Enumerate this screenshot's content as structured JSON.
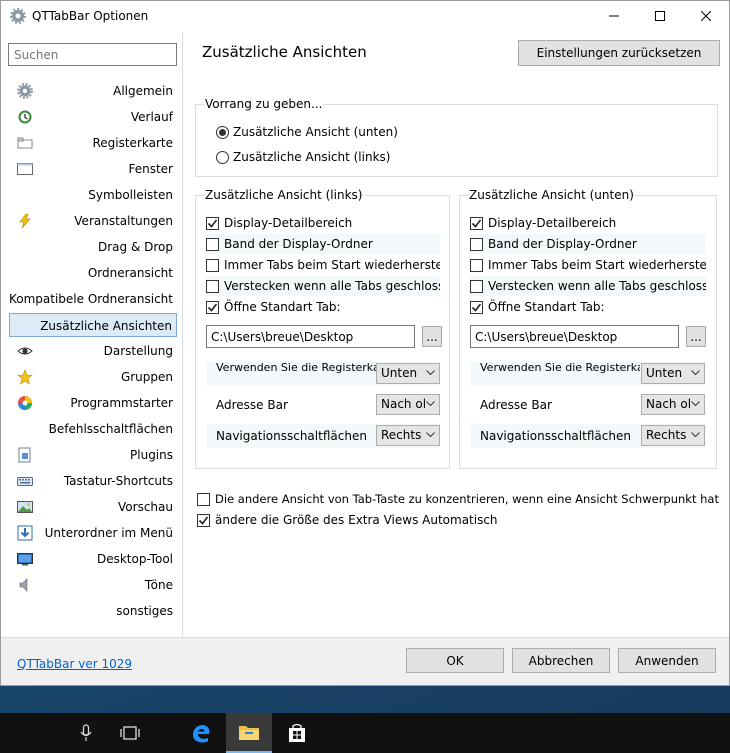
{
  "window": {
    "title": "QTTabBar Optionen"
  },
  "sidebar": {
    "search_placeholder": "Suchen",
    "items": [
      {
        "label": "Allgemein",
        "icon": "gear-icon"
      },
      {
        "label": "Verlauf",
        "icon": "history-icon"
      },
      {
        "label": "Registerkarte",
        "icon": "tab-icon"
      },
      {
        "label": "Fenster",
        "icon": "window-icon"
      },
      {
        "label": "Symbolleisten",
        "icon": ""
      },
      {
        "label": "Veranstaltungen",
        "icon": "lightning-icon"
      },
      {
        "label": "Drag & Drop",
        "icon": ""
      },
      {
        "label": "Ordneransicht",
        "icon": ""
      },
      {
        "label": "Kompatibele Ordneransicht",
        "icon": ""
      },
      {
        "label": "Zusätzliche Ansichten",
        "icon": ""
      },
      {
        "label": "Darstellung",
        "icon": "eye-icon"
      },
      {
        "label": "Gruppen",
        "icon": "star-icon"
      },
      {
        "label": "Programmstarter",
        "icon": "color-wheel-icon"
      },
      {
        "label": "Befehlsschaltflächen",
        "icon": ""
      },
      {
        "label": "Plugins",
        "icon": "plugin-icon"
      },
      {
        "label": "Tastatur-Shortcuts",
        "icon": "keyboard-icon"
      },
      {
        "label": "Vorschau",
        "icon": "preview-icon"
      },
      {
        "label": "Unterordner im Menü",
        "icon": "subfolder-icon"
      },
      {
        "label": "Desktop-Tool",
        "icon": "desktop-icon"
      },
      {
        "label": "Töne",
        "icon": "speaker-icon"
      },
      {
        "label": "sonstiges",
        "icon": ""
      }
    ],
    "selected_index": 9
  },
  "main": {
    "title": "Zusätzliche Ansichten",
    "reset_label": "Einstellungen zurücksetzen",
    "priority": {
      "title": "Vorrang zu geben...",
      "options": [
        "Zusätzliche Ansicht (unten)",
        "Zusätzliche Ansicht (links)"
      ],
      "selected_index": 0
    },
    "left_panel": {
      "title": "Zusätzliche Ansicht (links)",
      "checks": [
        {
          "label": "Display-Detailbereich",
          "checked": true
        },
        {
          "label": "Band der Display-Ordner",
          "checked": false
        },
        {
          "label": "Immer Tabs beim Start wiederherstellen",
          "checked": false
        },
        {
          "label": "Verstecken wenn alle Tabs geschlossen sind",
          "checked": false
        },
        {
          "label": "Öffne Standart Tab:",
          "checked": true
        }
      ],
      "path": "C:\\Users\\breue\\Desktop",
      "browse_label": "...",
      "props": [
        {
          "label": "Verwenden Sie die Registerkarten",
          "value": "Unten"
        },
        {
          "label": "Adresse Bar",
          "value": "Nach ol"
        },
        {
          "label": "Navigationsschaltflächen",
          "value": "Rechts"
        }
      ]
    },
    "right_panel": {
      "title": "Zusätzliche Ansicht (unten)",
      "checks": [
        {
          "label": "Display-Detailbereich",
          "checked": true
        },
        {
          "label": "Band der Display-Ordner",
          "checked": false
        },
        {
          "label": "Immer Tabs beim Start wiederherstellen",
          "checked": false
        },
        {
          "label": "Verstecken wenn alle Tabs geschlossen sind",
          "checked": false
        },
        {
          "label": "Öffne Standart Tab:",
          "checked": true
        }
      ],
      "path": "C:\\Users\\breue\\Desktop",
      "browse_label": "...",
      "props": [
        {
          "label": "Verwenden Sie die Registerkarten",
          "value": "Unten"
        },
        {
          "label": "Adresse Bar",
          "value": "Nach ol"
        },
        {
          "label": "Navigationsschaltflächen",
          "value": "Rechts"
        }
      ]
    },
    "bottom_checks": [
      {
        "label": "Die andere Ansicht von Tab-Taste zu konzentrieren, wenn eine Ansicht Schwerpunkt hat",
        "checked": false
      },
      {
        "label": "ändere die Größe des Extra Views Automatisch",
        "checked": true
      }
    ]
  },
  "footer": {
    "version": "QTTabBar ver 1029",
    "ok": "OK",
    "cancel": "Abbrechen",
    "apply": "Anwenden"
  },
  "taskbar": {
    "icons": [
      "microphone-icon",
      "task-view-icon",
      "edge-icon",
      "file-explorer-icon",
      "store-icon"
    ],
    "active": "file-explorer-icon"
  }
}
